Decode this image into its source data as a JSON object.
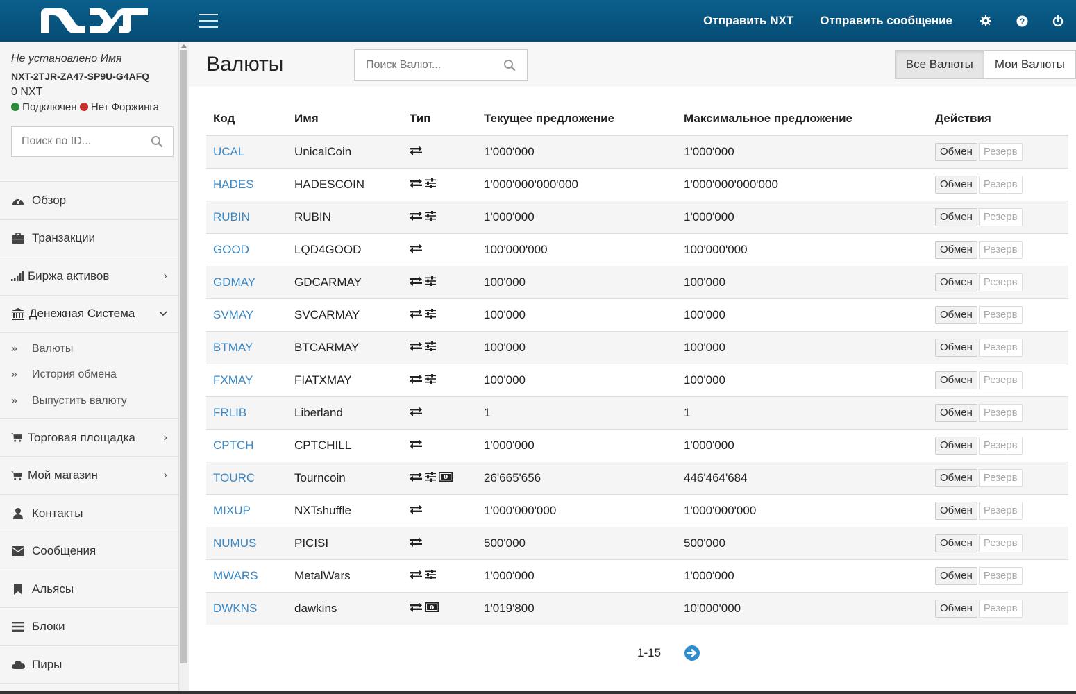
{
  "header": {
    "send_nxt": "Отправить NXT",
    "send_message": "Отправить сообщение",
    "icons": [
      "gear-icon",
      "help-icon",
      "power-icon"
    ]
  },
  "user": {
    "name": "Не установлено Имя",
    "account": "NXT-2TJR-ZA47-SP9U-G4AFQ",
    "balance": "0 NXT",
    "status_connected": "Подключен",
    "status_forging": "Нет Форжинга"
  },
  "sidebar": {
    "search_placeholder": "Поиск по ID...",
    "items": [
      {
        "label": "Обзор",
        "icon": "dashboard-icon"
      },
      {
        "label": "Транзакции",
        "icon": "briefcase-icon"
      },
      {
        "label": "Биржа активов",
        "icon": "signal-icon"
      },
      {
        "label": "Денежная Система",
        "icon": "bank-icon"
      },
      {
        "label": "Торговая площадка",
        "icon": "cart-icon"
      },
      {
        "label": "Мой магазин",
        "icon": "cart-icon"
      },
      {
        "label": "Контакты",
        "icon": "user-icon"
      },
      {
        "label": "Сообщения",
        "icon": "envelope-icon"
      },
      {
        "label": "Альясы",
        "icon": "bookmark-icon"
      },
      {
        "label": "Блоки",
        "icon": "list-icon"
      },
      {
        "label": "Пиры",
        "icon": "cloud-icon"
      }
    ],
    "subitems": [
      "Валюты",
      "История обмена",
      "Выпустить валюту"
    ]
  },
  "main": {
    "title": "Валюты",
    "search_placeholder": "Поиск Валют...",
    "tabs": [
      "Все Валюты",
      "Мои Валюты"
    ],
    "columns": [
      "Код",
      "Имя",
      "Тип",
      "Текущее предложение",
      "Максимальное предложение",
      "Действия"
    ],
    "exchange_label": "Обмен",
    "reserve_label": "Резерв",
    "rows": [
      {
        "code": "UCAL",
        "name": "UnicalCoin",
        "types": [
          "exchange"
        ],
        "current": "1'000'000",
        "max": "1'000'000"
      },
      {
        "code": "HADES",
        "name": "HADESCOIN",
        "types": [
          "exchange",
          "controllable"
        ],
        "current": "1'000'000'000'000",
        "max": "1'000'000'000'000"
      },
      {
        "code": "RUBIN",
        "name": "RUBIN",
        "types": [
          "exchange",
          "controllable"
        ],
        "current": "1'000'000",
        "max": "1'000'000"
      },
      {
        "code": "GOOD",
        "name": "LQD4GOOD",
        "types": [
          "exchange"
        ],
        "current": "100'000'000",
        "max": "100'000'000"
      },
      {
        "code": "GDMAY",
        "name": "GDCARMAY",
        "types": [
          "exchange",
          "controllable"
        ],
        "current": "100'000",
        "max": "100'000"
      },
      {
        "code": "SVMAY",
        "name": "SVCARMAY",
        "types": [
          "exchange",
          "controllable"
        ],
        "current": "100'000",
        "max": "100'000"
      },
      {
        "code": "BTMAY",
        "name": "BTCARMAY",
        "types": [
          "exchange",
          "controllable"
        ],
        "current": "100'000",
        "max": "100'000"
      },
      {
        "code": "FXMAY",
        "name": "FIATXMAY",
        "types": [
          "exchange",
          "controllable"
        ],
        "current": "100'000",
        "max": "100'000"
      },
      {
        "code": "FRLIB",
        "name": "Liberland",
        "types": [
          "exchange"
        ],
        "current": "1",
        "max": "1"
      },
      {
        "code": "CPTCH",
        "name": "CPTCHILL",
        "types": [
          "exchange"
        ],
        "current": "1'000'000",
        "max": "1'000'000"
      },
      {
        "code": "TOURC",
        "name": "Tourncoin",
        "types": [
          "exchange",
          "controllable",
          "mintable"
        ],
        "current": "26'665'656",
        "max": "446'464'684"
      },
      {
        "code": "MIXUP",
        "name": "NXTshuffle",
        "types": [
          "exchange"
        ],
        "current": "1'000'000'000",
        "max": "1'000'000'000"
      },
      {
        "code": "NUMUS",
        "name": "PICISI",
        "types": [
          "exchange"
        ],
        "current": "500'000",
        "max": "500'000"
      },
      {
        "code": "MWARS",
        "name": "MetalWars",
        "types": [
          "exchange",
          "controllable"
        ],
        "current": "1'000'000",
        "max": "1'000'000"
      },
      {
        "code": "DWKNS",
        "name": "dawkins",
        "types": [
          "exchange",
          "mintable"
        ],
        "current": "1'019'800",
        "max": "10'000'000"
      }
    ],
    "pager": "1-15"
  },
  "colors": {
    "header": "#054c74",
    "link": "#3a87c3",
    "connected": "#2e8b3c",
    "not_forging": "#c9302c"
  }
}
